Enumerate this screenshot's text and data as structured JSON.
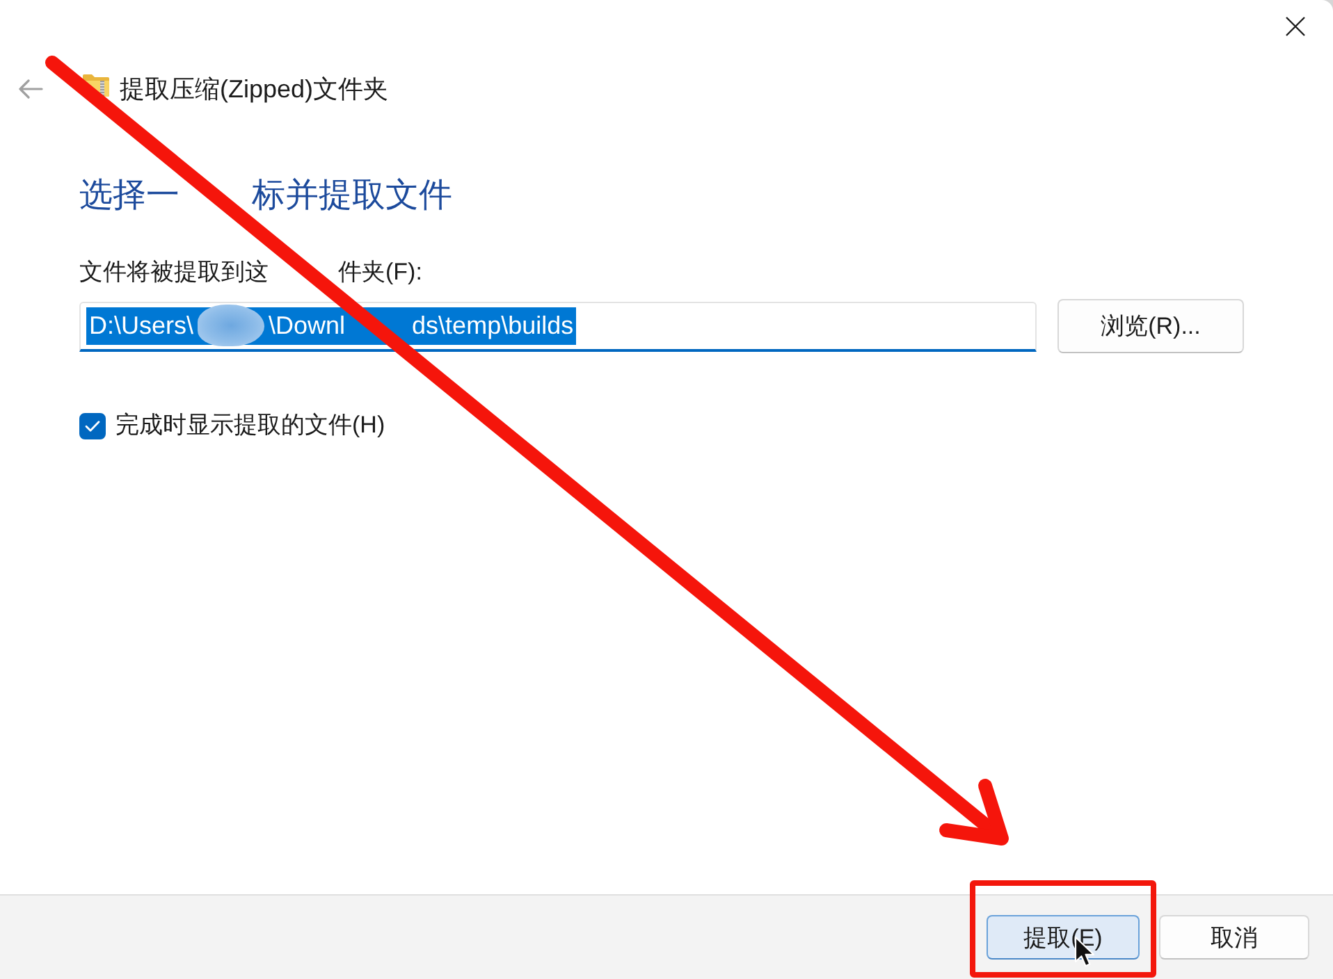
{
  "header": {
    "back_button": {
      "disabled": true
    },
    "title": "提取压缩(Zipped)文件夹"
  },
  "instruction": [
    "选择一",
    "标并提取文件"
  ],
  "destination": {
    "label": [
      "文件将被提取到这",
      "件夹(F):"
    ],
    "path_start": "D:\\Users\\",
    "path_rest": [
      "\\Downl",
      "ds\\temp\\builds"
    ],
    "redacted": true,
    "selected": true,
    "focused": true
  },
  "browse_button": {
    "label": "浏览(R)..."
  },
  "show_files": {
    "label": "完成时显示提取的文件(H)",
    "checked": true
  },
  "buttons": [
    {
      "label": "提取(E)",
      "kind": "default",
      "highlighted": true
    },
    {
      "label": "取消",
      "kind": "normal",
      "highlighted": false
    }
  ]
}
